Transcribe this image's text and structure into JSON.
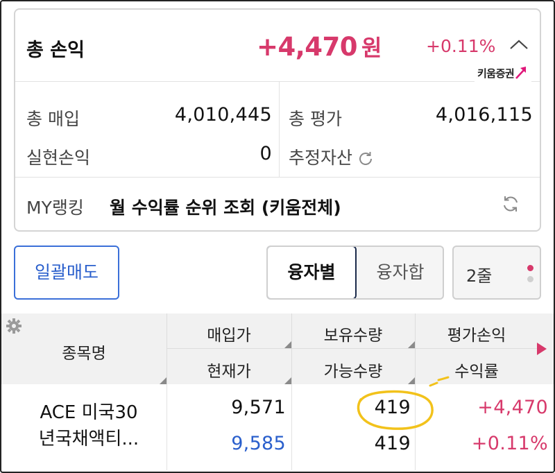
{
  "summary": {
    "total_label": "총 손익",
    "total_amount": "+4,470",
    "total_unit": "원",
    "total_rate": "+0.11%",
    "brand": "키움증권",
    "purchase_label": "총 매입",
    "purchase_value": "4,010,445",
    "evaluation_label": "총 평가",
    "evaluation_value": "4,016,115",
    "realized_label": "실현손익",
    "realized_value": "0",
    "estimated_label": "추정자산",
    "ranking_label": "MY랭킹",
    "ranking_text": "월 수익률 순위 조회 (키움전체)"
  },
  "actions": {
    "bulk_sell": "일괄매도",
    "tab_by_loan": "융자별",
    "tab_loan_sum": "융자합",
    "rows_option": "2줄"
  },
  "table": {
    "headers": {
      "name": "종목명",
      "buy_price": "매입가",
      "current_price": "현재가",
      "holding_qty": "보유수량",
      "available_qty": "가능수량",
      "eval_pl": "평가손익",
      "return_rate": "수익률"
    },
    "rows": [
      {
        "name_line1": "ACE 미국30",
        "name_line2": "년국채액티...",
        "buy_price": "9,571",
        "current_price": "9,585",
        "holding_qty": "419",
        "available_qty": "419",
        "eval_pl": "+4,470",
        "return_rate": "+0.11%"
      }
    ]
  },
  "colors": {
    "profit": "#d7396b",
    "current_price": "#2a5fcc",
    "highlight": "#f2c21b",
    "brand_arrow": "#e0177a"
  }
}
